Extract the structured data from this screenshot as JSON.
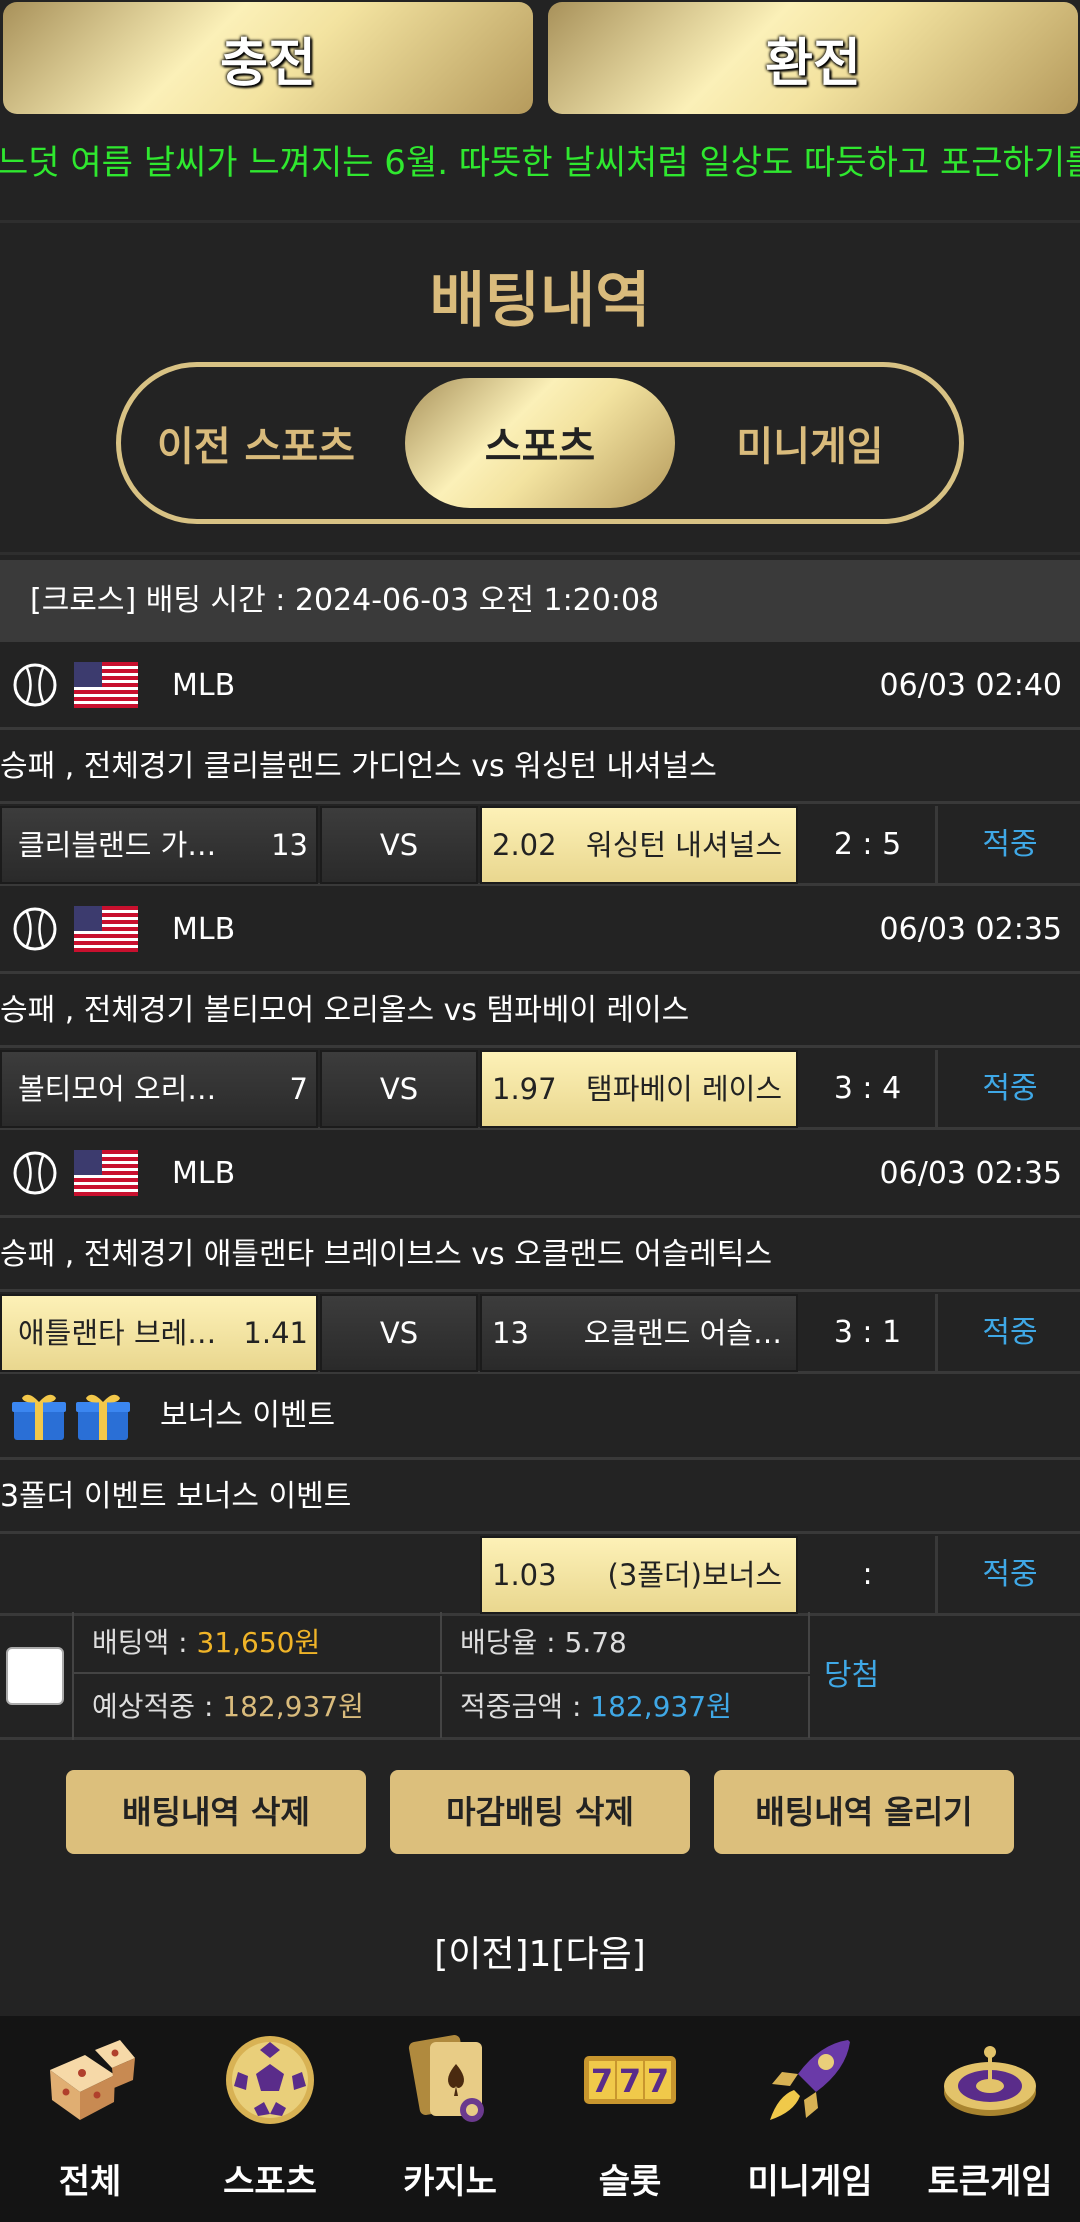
{
  "top_buttons": {
    "charge": "충전",
    "exchange": "환전"
  },
  "ticker": "느덧 여름 날씨가 느껴지는 6월. 따뜻한 날씨처럼 일상도 따듯하고 포근하기를",
  "page_title": "배팅내역",
  "tabs": [
    "이전 스포츠",
    "스포츠",
    "미니게임"
  ],
  "active_tab": "스포츠",
  "bet_header": "[크로스] 배팅 시간 : 2024-06-03 오전 1:20:08",
  "games": [
    {
      "league": "MLB",
      "time": "06/03 02:40",
      "match": "승패 , 전체경기 클리블랜드 가디언스  vs  워싱턴 내셔널스",
      "home": "클리블랜드 가…",
      "home_odds": "13",
      "vs": "VS",
      "away": "워싱턴 내셔널스",
      "away_odds": "2.02",
      "selected": "away",
      "score": "2 : 5",
      "result": "적중"
    },
    {
      "league": "MLB",
      "time": "06/03 02:35",
      "match": "승패 , 전체경기 볼티모어 오리올스  vs  탬파베이 레이스",
      "home": "볼티모어 오리…",
      "home_odds": "7",
      "vs": "VS",
      "away": "탬파베이 레이스",
      "away_odds": "1.97",
      "selected": "away",
      "score": "3 : 4",
      "result": "적중"
    },
    {
      "league": "MLB",
      "time": "06/03 02:35",
      "match": "승패 , 전체경기 애틀랜타 브레이브스  vs  오클랜드 어슬레틱스",
      "home": "애틀랜타 브레…",
      "home_odds": "1.41",
      "vs": "VS",
      "away": "오클랜드 어슬…",
      "away_odds": "13",
      "selected": "home",
      "score": "3 : 1",
      "result": "적중"
    }
  ],
  "bonus": {
    "title": "보너스 이벤트",
    "match": "3폴더 이벤트 보너스 이벤트",
    "odds": "1.03",
    "name": "(3폴더)보너스",
    "score": ":",
    "result": "적중"
  },
  "summary": {
    "bet_amount_label": "배팅액 : ",
    "bet_amount": "31,650원",
    "odds_label": "배당율 : ",
    "odds": "5.78",
    "expected_label": "예상적중 : ",
    "expected": "182,937원",
    "hit_label": "적중금액 : ",
    "hit": "182,937원",
    "status": "당첨"
  },
  "actions": [
    "배팅내역 삭제",
    "마감배팅 삭제",
    "배팅내역 올리기"
  ],
  "pager": "[이전]1[다음]",
  "bottom_nav": [
    {
      "label": "전체",
      "icon": "dice-icon"
    },
    {
      "label": "스포츠",
      "icon": "soccer-ball-icon"
    },
    {
      "label": "카지노",
      "icon": "cards-icon"
    },
    {
      "label": "슬롯",
      "icon": "slot-777-icon"
    },
    {
      "label": "미니게임",
      "icon": "rocket-icon"
    },
    {
      "label": "토큰게임",
      "icon": "roulette-icon"
    }
  ],
  "colors": {
    "gold": "#d9bb7c",
    "ticker_green": "#2fe82f",
    "result_blue": "#3fa8e6",
    "amount_orange": "#f0b428",
    "background": "#232323"
  }
}
